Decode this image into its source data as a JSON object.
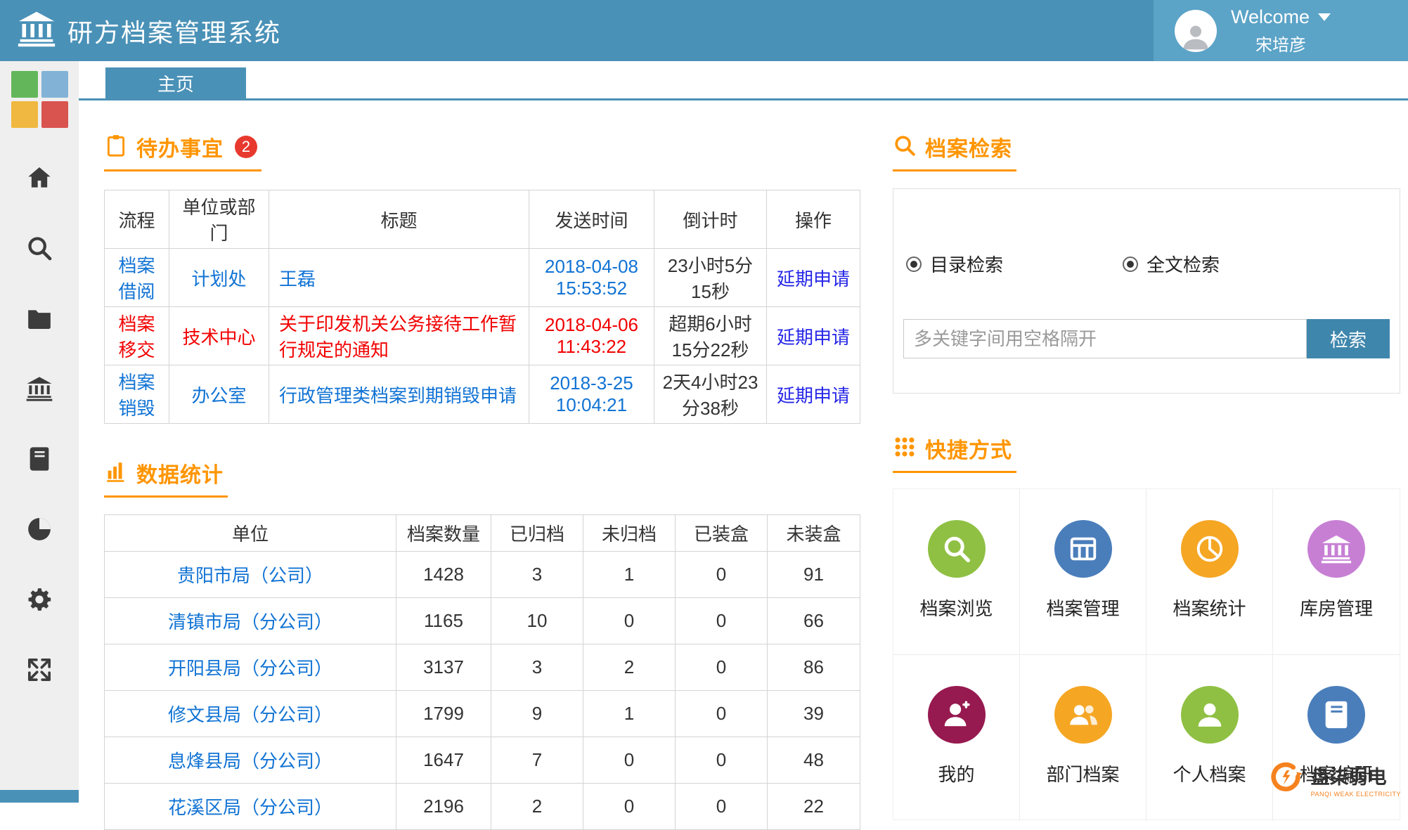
{
  "theme": {
    "header_blue": "#4a91b7",
    "header_blue_light": "#5ba3c7",
    "accent_orange": "#ff9500",
    "badge_red": "#e8392e",
    "link_blue": "#1173d4",
    "action_blue": "#2727e8",
    "alert_red": "#f20000",
    "countdown_orange": "#ff7e00",
    "button_blue": "#3f86ac"
  },
  "header": {
    "title": "研方档案管理系统",
    "welcome": "Welcome",
    "username": "宋培彦"
  },
  "sidebar": {
    "items": [
      {
        "icon": "home-icon"
      },
      {
        "icon": "search-icon"
      },
      {
        "icon": "folder-icon"
      },
      {
        "icon": "bank-icon"
      },
      {
        "icon": "book-icon"
      },
      {
        "icon": "pie-chart-icon"
      },
      {
        "icon": "gear-icon"
      },
      {
        "icon": "expand-icon"
      }
    ]
  },
  "tabs": [
    {
      "label": "主页"
    }
  ],
  "todo": {
    "title": "待办事宜",
    "badge": "2",
    "columns": [
      "流程",
      "单位或部门",
      "标题",
      "发送时间",
      "倒计时",
      "操作"
    ],
    "rows": [
      {
        "flow": "档案借阅",
        "dept": "计划处",
        "subject": "王磊",
        "time": "2018-04-08 15:53:52",
        "countdown": "23小时5分15秒",
        "action": "延期申请"
      },
      {
        "flow": "档案移交",
        "dept": "技术中心",
        "subject": "关于印发机关公务接待工作暂行规定的通知",
        "time": "2018-04-06 11:43:22",
        "countdown": "超期6小时15分22秒",
        "action": "延期申请"
      },
      {
        "flow": "档案销毁",
        "dept": "办公室",
        "subject": "行政管理类档案到期销毁申请",
        "time": "2018-3-25 10:04:21",
        "countdown": "2天4小时23分38秒",
        "action": "延期申请"
      }
    ]
  },
  "stats": {
    "title": "数据统计",
    "columns": [
      "单位",
      "档案数量",
      "已归档",
      "未归档",
      "已装盒",
      "未装盒"
    ],
    "rows": [
      {
        "unit": "贵阳市局（公司）",
        "total": "1428",
        "archived": "3",
        "unarchived": "1",
        "boxed": "0",
        "unboxed": "91"
      },
      {
        "unit": "清镇市局（分公司）",
        "total": "1165",
        "archived": "10",
        "unarchived": "0",
        "boxed": "0",
        "unboxed": "66"
      },
      {
        "unit": "开阳县局（分公司）",
        "total": "3137",
        "archived": "3",
        "unarchived": "2",
        "boxed": "0",
        "unboxed": "86"
      },
      {
        "unit": "修文县局（分公司）",
        "total": "1799",
        "archived": "9",
        "unarchived": "1",
        "boxed": "0",
        "unboxed": "39"
      },
      {
        "unit": "息烽县局（分公司）",
        "total": "1647",
        "archived": "7",
        "unarchived": "0",
        "boxed": "0",
        "unboxed": "48"
      },
      {
        "unit": "花溪区局（分公司）",
        "total": "2196",
        "archived": "2",
        "unarchived": "0",
        "boxed": "0",
        "unboxed": "22"
      }
    ]
  },
  "search": {
    "title": "档案检索",
    "options": [
      {
        "label": "目录检索",
        "selected": true
      },
      {
        "label": "全文检索",
        "selected": true
      }
    ],
    "placeholder": "多关键字间用空格隔开",
    "button": "检索"
  },
  "shortcuts": {
    "title": "快捷方式",
    "items": [
      {
        "label": "档案浏览",
        "color": "#8fc043",
        "icon": "search-icon"
      },
      {
        "label": "档案管理",
        "color": "#4a7ebb",
        "icon": "table-icon"
      },
      {
        "label": "档案统计",
        "color": "#f5a album623",
        "icon": "pie-icon"
      },
      {
        "label": "库房管理",
        "color": "#c77fd4",
        "icon": "bank-icon"
      },
      {
        "label": "我的",
        "color": "#96194f",
        "icon": "person-plus-icon"
      },
      {
        "label": "部门档案",
        "color": "#f5a623",
        "icon": "people-icon"
      },
      {
        "label": "个人档案",
        "color": "#8fc043",
        "icon": "person-icon"
      },
      {
        "label": "档案编研",
        "color": "#4a7ebb",
        "icon": "book-icon"
      }
    ]
  },
  "footer_logo": {
    "name": "盘柒弱电",
    "sub": "PANQI WEAK ELECTRICITY"
  }
}
